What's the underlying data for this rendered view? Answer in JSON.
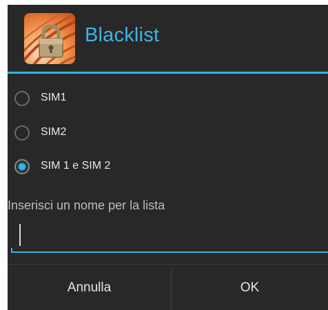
{
  "dialog": {
    "title": "Blacklist",
    "app_icon": "padlock-icon",
    "accent_color": "#33b5e5",
    "background_color": "#282828"
  },
  "sim_options": [
    {
      "label": "SIM1",
      "checked": false
    },
    {
      "label": "SIM2",
      "checked": false
    },
    {
      "label": "SIM 1 e SIM 2",
      "checked": true
    }
  ],
  "name_prompt": "Inserisci un nome per la lista",
  "name_input": {
    "value": "",
    "placeholder": ""
  },
  "buttons": {
    "cancel_label": "Annulla",
    "ok_label": "OK"
  }
}
